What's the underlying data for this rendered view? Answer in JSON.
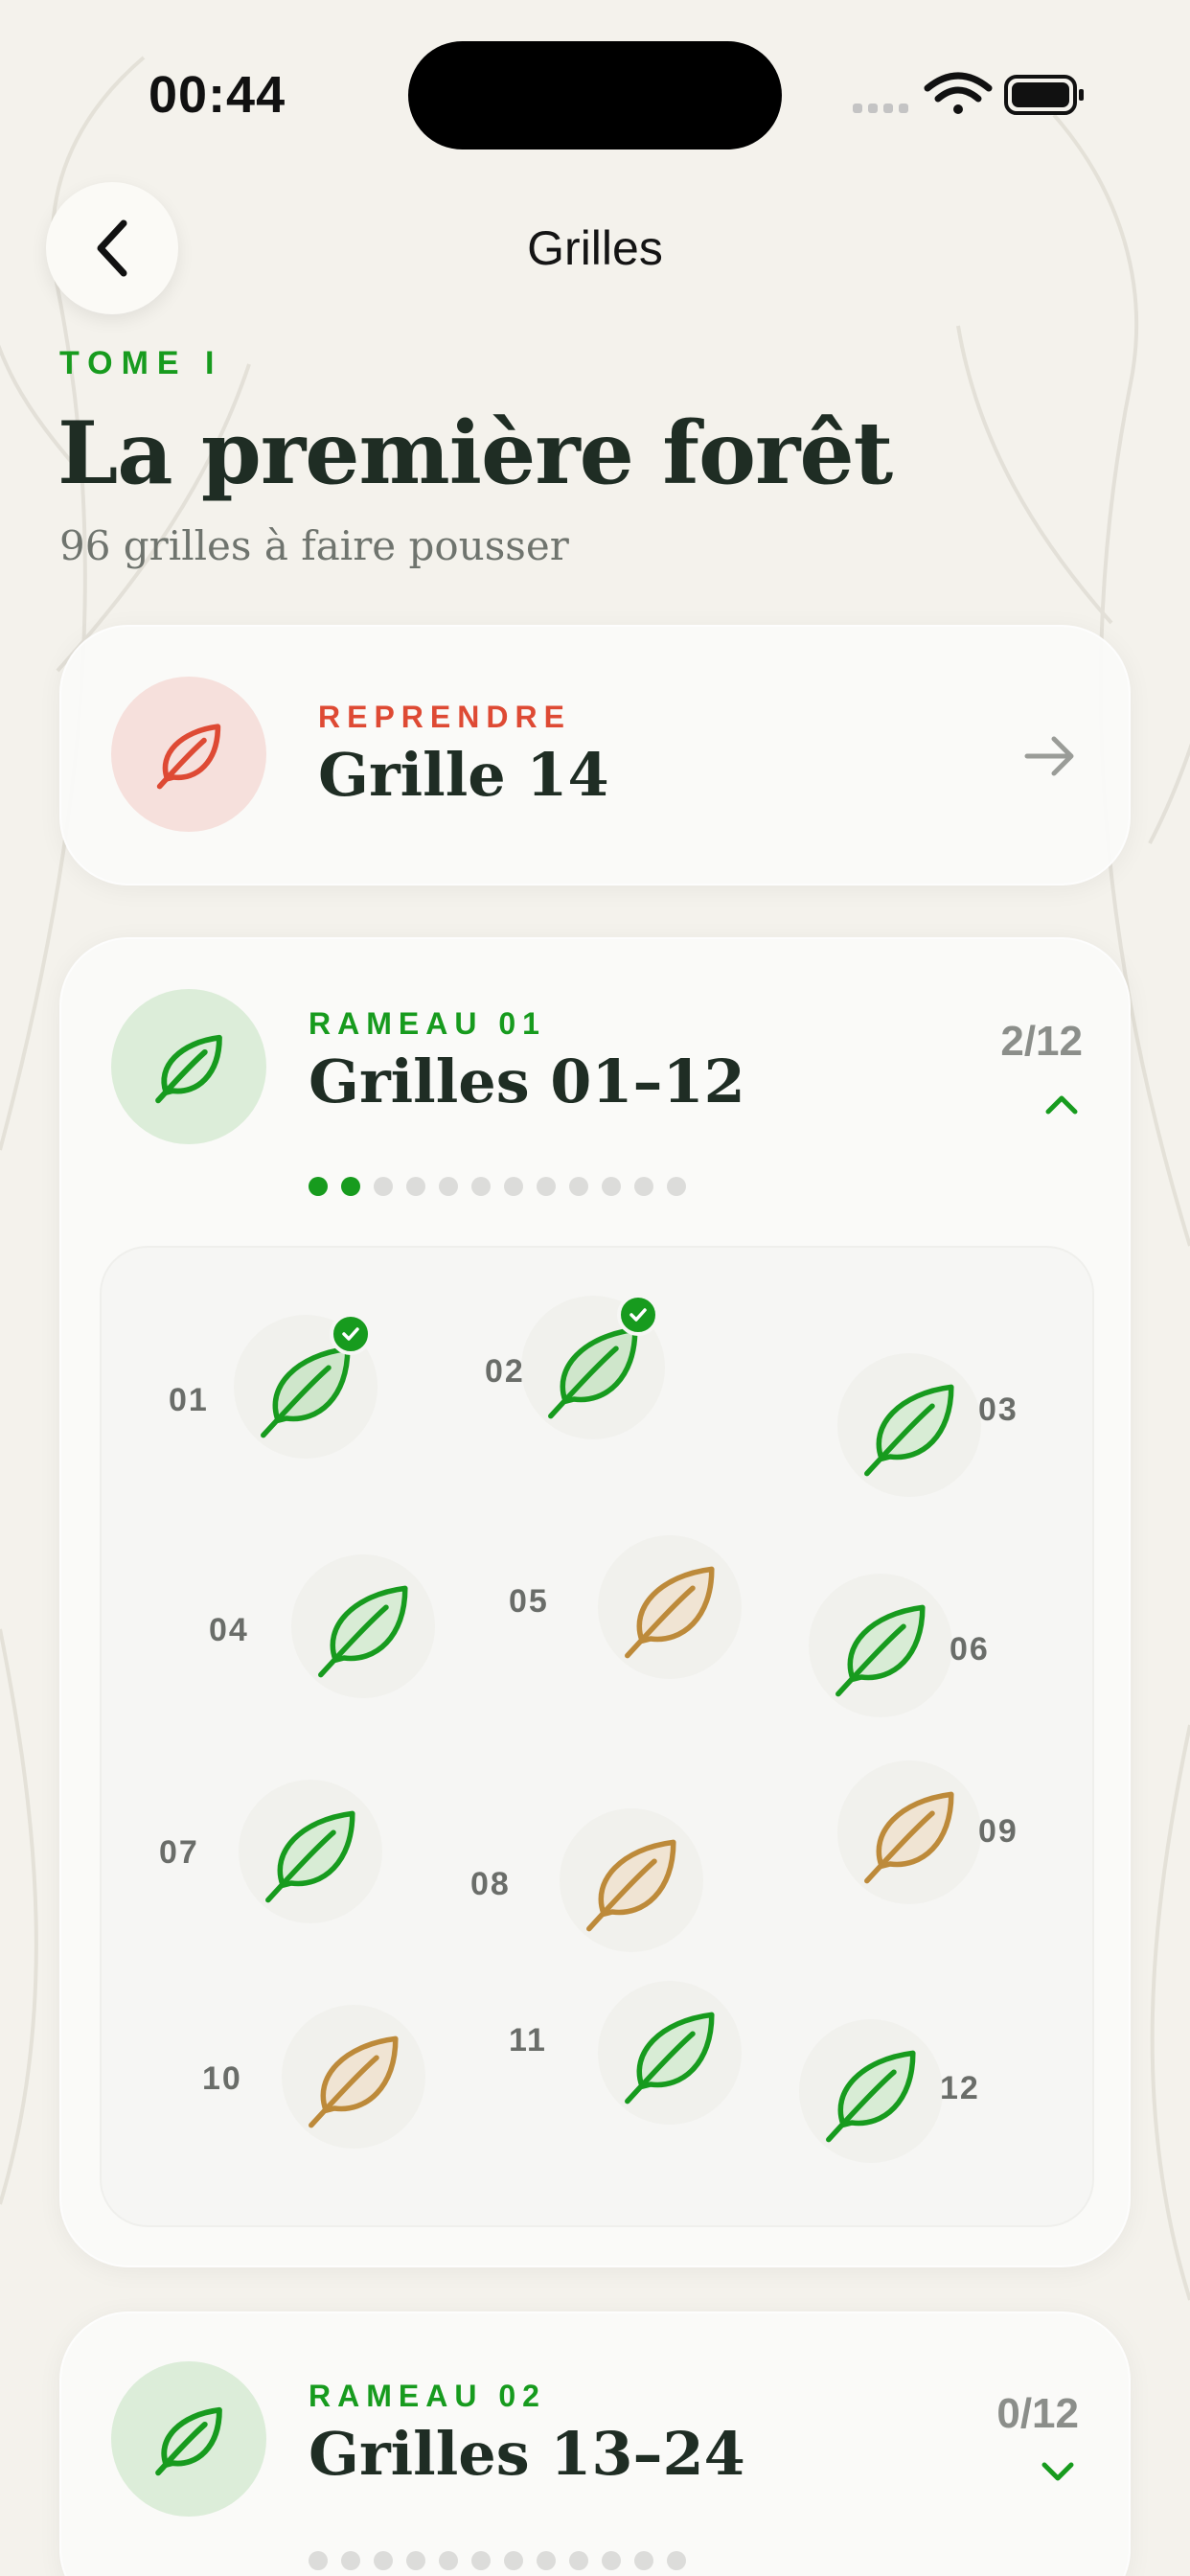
{
  "status": {
    "time": "00:44"
  },
  "nav": {
    "title": "Grilles"
  },
  "header": {
    "tome": "TOME I",
    "title": "La première forêt",
    "subtitle": "96 grilles à faire pousser"
  },
  "resume": {
    "label": "REPRENDRE",
    "title": "Grille 14"
  },
  "rameaux": [
    {
      "label": "RAMEAU 01",
      "title": "Grilles 01–12",
      "count": "2/12",
      "expanded": true,
      "completed": 2,
      "total": 12
    },
    {
      "label": "RAMEAU 02",
      "title": "Grilles 13–24",
      "count": "0/12",
      "expanded": false,
      "completed": 0,
      "total": 12
    }
  ],
  "grilles": [
    {
      "num": "01",
      "state": "done"
    },
    {
      "num": "02",
      "state": "done"
    },
    {
      "num": "03",
      "state": "green"
    },
    {
      "num": "04",
      "state": "green"
    },
    {
      "num": "05",
      "state": "brown"
    },
    {
      "num": "06",
      "state": "green"
    },
    {
      "num": "07",
      "state": "green"
    },
    {
      "num": "08",
      "state": "brown"
    },
    {
      "num": "09",
      "state": "brown"
    },
    {
      "num": "10",
      "state": "brown"
    },
    {
      "num": "11",
      "state": "green"
    },
    {
      "num": "12",
      "state": "green"
    }
  ],
  "colors": {
    "accent_green": "#179b1e",
    "accent_red": "#de4a34",
    "leaf_brown": "#bd8a3a",
    "title_dark": "#1f2d24"
  },
  "icons": {
    "back": "chevron-left-icon",
    "resume": "leaf-icon",
    "arrow": "arrow-right-icon",
    "expand": "chevron-up-icon",
    "collapse": "chevron-down-icon",
    "done": "checkmark-icon"
  }
}
